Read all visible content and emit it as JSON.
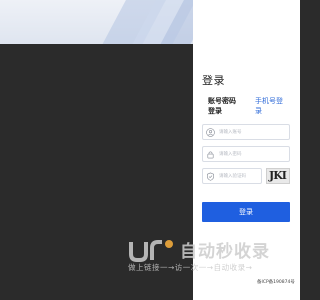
{
  "login": {
    "title": "登录",
    "tabs": [
      {
        "label": "账号密码登录"
      },
      {
        "label": "手机号登录"
      }
    ],
    "username_placeholder": "请输入账号",
    "password_placeholder": "请输入密码",
    "captcha_placeholder": "请输入验证码",
    "captcha_text": "JKI",
    "submit_label": "登录",
    "footer": "备ICP备190874号"
  },
  "watermark": {
    "title": "自动秒收录",
    "subtitle": "做上链接一→访一次一→自动收录→"
  },
  "colors": {
    "accent": "#1f5fe0",
    "tab_link": "#2f6bd8",
    "dark_bg": "#2b2b2b"
  }
}
